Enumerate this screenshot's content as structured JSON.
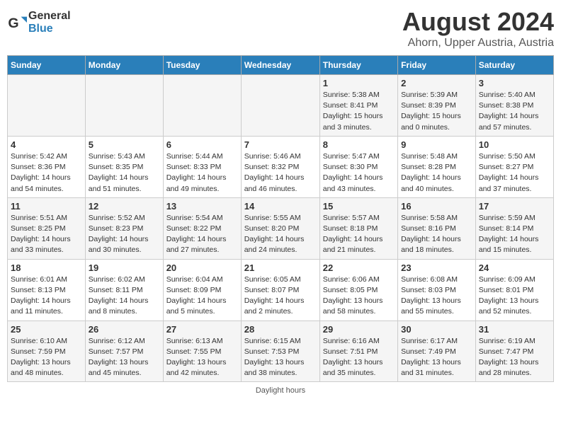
{
  "header": {
    "logo_line1": "General",
    "logo_line2": "Blue",
    "main_title": "August 2024",
    "subtitle": "Ahorn, Upper Austria, Austria"
  },
  "days_of_week": [
    "Sunday",
    "Monday",
    "Tuesday",
    "Wednesday",
    "Thursday",
    "Friday",
    "Saturday"
  ],
  "weeks": [
    [
      {
        "day": "",
        "info": ""
      },
      {
        "day": "",
        "info": ""
      },
      {
        "day": "",
        "info": ""
      },
      {
        "day": "",
        "info": ""
      },
      {
        "day": "1",
        "info": "Sunrise: 5:38 AM\nSunset: 8:41 PM\nDaylight: 15 hours\nand 3 minutes."
      },
      {
        "day": "2",
        "info": "Sunrise: 5:39 AM\nSunset: 8:39 PM\nDaylight: 15 hours\nand 0 minutes."
      },
      {
        "day": "3",
        "info": "Sunrise: 5:40 AM\nSunset: 8:38 PM\nDaylight: 14 hours\nand 57 minutes."
      }
    ],
    [
      {
        "day": "4",
        "info": "Sunrise: 5:42 AM\nSunset: 8:36 PM\nDaylight: 14 hours\nand 54 minutes."
      },
      {
        "day": "5",
        "info": "Sunrise: 5:43 AM\nSunset: 8:35 PM\nDaylight: 14 hours\nand 51 minutes."
      },
      {
        "day": "6",
        "info": "Sunrise: 5:44 AM\nSunset: 8:33 PM\nDaylight: 14 hours\nand 49 minutes."
      },
      {
        "day": "7",
        "info": "Sunrise: 5:46 AM\nSunset: 8:32 PM\nDaylight: 14 hours\nand 46 minutes."
      },
      {
        "day": "8",
        "info": "Sunrise: 5:47 AM\nSunset: 8:30 PM\nDaylight: 14 hours\nand 43 minutes."
      },
      {
        "day": "9",
        "info": "Sunrise: 5:48 AM\nSunset: 8:28 PM\nDaylight: 14 hours\nand 40 minutes."
      },
      {
        "day": "10",
        "info": "Sunrise: 5:50 AM\nSunset: 8:27 PM\nDaylight: 14 hours\nand 37 minutes."
      }
    ],
    [
      {
        "day": "11",
        "info": "Sunrise: 5:51 AM\nSunset: 8:25 PM\nDaylight: 14 hours\nand 33 minutes."
      },
      {
        "day": "12",
        "info": "Sunrise: 5:52 AM\nSunset: 8:23 PM\nDaylight: 14 hours\nand 30 minutes."
      },
      {
        "day": "13",
        "info": "Sunrise: 5:54 AM\nSunset: 8:22 PM\nDaylight: 14 hours\nand 27 minutes."
      },
      {
        "day": "14",
        "info": "Sunrise: 5:55 AM\nSunset: 8:20 PM\nDaylight: 14 hours\nand 24 minutes."
      },
      {
        "day": "15",
        "info": "Sunrise: 5:57 AM\nSunset: 8:18 PM\nDaylight: 14 hours\nand 21 minutes."
      },
      {
        "day": "16",
        "info": "Sunrise: 5:58 AM\nSunset: 8:16 PM\nDaylight: 14 hours\nand 18 minutes."
      },
      {
        "day": "17",
        "info": "Sunrise: 5:59 AM\nSunset: 8:14 PM\nDaylight: 14 hours\nand 15 minutes."
      }
    ],
    [
      {
        "day": "18",
        "info": "Sunrise: 6:01 AM\nSunset: 8:13 PM\nDaylight: 14 hours\nand 11 minutes."
      },
      {
        "day": "19",
        "info": "Sunrise: 6:02 AM\nSunset: 8:11 PM\nDaylight: 14 hours\nand 8 minutes."
      },
      {
        "day": "20",
        "info": "Sunrise: 6:04 AM\nSunset: 8:09 PM\nDaylight: 14 hours\nand 5 minutes."
      },
      {
        "day": "21",
        "info": "Sunrise: 6:05 AM\nSunset: 8:07 PM\nDaylight: 14 hours\nand 2 minutes."
      },
      {
        "day": "22",
        "info": "Sunrise: 6:06 AM\nSunset: 8:05 PM\nDaylight: 13 hours\nand 58 minutes."
      },
      {
        "day": "23",
        "info": "Sunrise: 6:08 AM\nSunset: 8:03 PM\nDaylight: 13 hours\nand 55 minutes."
      },
      {
        "day": "24",
        "info": "Sunrise: 6:09 AM\nSunset: 8:01 PM\nDaylight: 13 hours\nand 52 minutes."
      }
    ],
    [
      {
        "day": "25",
        "info": "Sunrise: 6:10 AM\nSunset: 7:59 PM\nDaylight: 13 hours\nand 48 minutes."
      },
      {
        "day": "26",
        "info": "Sunrise: 6:12 AM\nSunset: 7:57 PM\nDaylight: 13 hours\nand 45 minutes."
      },
      {
        "day": "27",
        "info": "Sunrise: 6:13 AM\nSunset: 7:55 PM\nDaylight: 13 hours\nand 42 minutes."
      },
      {
        "day": "28",
        "info": "Sunrise: 6:15 AM\nSunset: 7:53 PM\nDaylight: 13 hours\nand 38 minutes."
      },
      {
        "day": "29",
        "info": "Sunrise: 6:16 AM\nSunset: 7:51 PM\nDaylight: 13 hours\nand 35 minutes."
      },
      {
        "day": "30",
        "info": "Sunrise: 6:17 AM\nSunset: 7:49 PM\nDaylight: 13 hours\nand 31 minutes."
      },
      {
        "day": "31",
        "info": "Sunrise: 6:19 AM\nSunset: 7:47 PM\nDaylight: 13 hours\nand 28 minutes."
      }
    ]
  ],
  "footer": "Daylight hours"
}
